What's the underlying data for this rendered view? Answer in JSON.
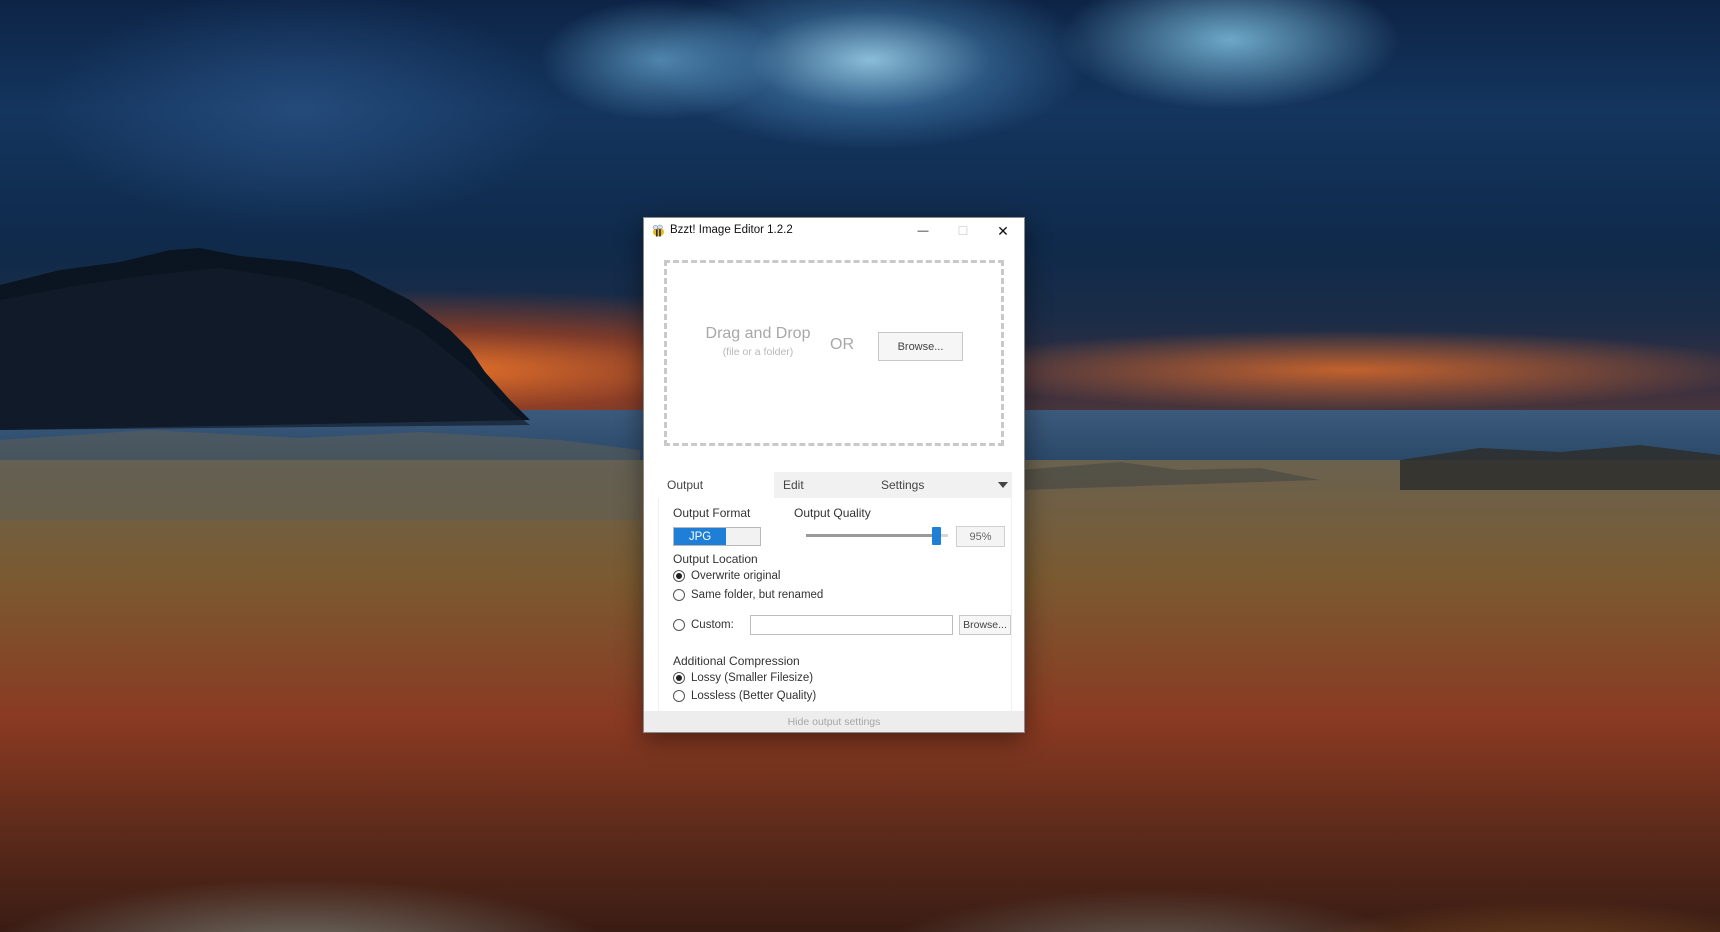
{
  "window": {
    "title": "Bzzt! Image Editor 1.2.2",
    "minimize_symbol": "—",
    "maximize_symbol": "☐",
    "close_symbol": "✕"
  },
  "dropzone": {
    "main_text": "Drag and Drop",
    "sub_text": "(file or a folder)",
    "or_text": "OR",
    "browse_label": "Browse..."
  },
  "tabs": [
    {
      "label": "Output",
      "active": true
    },
    {
      "label": "Edit",
      "active": false
    },
    {
      "label": "Settings",
      "active": false
    }
  ],
  "output": {
    "format_label": "Output Format",
    "format_selected": "JPG",
    "quality_label": "Output Quality",
    "quality_value": "95%",
    "quality_fraction": 0.95,
    "location_label": "Output Location",
    "location_options": [
      {
        "label": "Overwrite original",
        "checked": true
      },
      {
        "label": "Same folder, but renamed",
        "checked": false
      },
      {
        "label": "Custom:",
        "checked": false
      }
    ],
    "custom_path_value": "",
    "custom_browse_label": "Browse...",
    "compression_label": "Additional Compression",
    "compression_options": [
      {
        "label": "Lossy (Smaller Filesize)",
        "checked": true
      },
      {
        "label": "Lossless (Better Quality)",
        "checked": false
      }
    ]
  },
  "footer": {
    "toggle_label": "Hide output settings"
  },
  "colors": {
    "accent": "#1f7fd6"
  },
  "icons": {
    "app": "bee-icon",
    "tab_menu": "caret-down-icon"
  }
}
